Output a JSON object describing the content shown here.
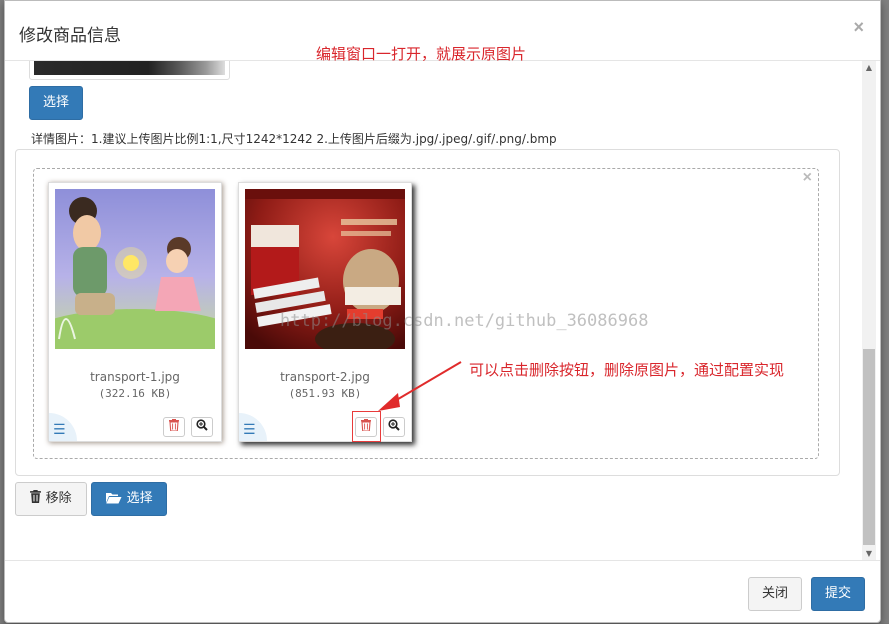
{
  "modal": {
    "title": "修改商品信息",
    "close_symbol": "×"
  },
  "annotations": {
    "top": "编辑窗口一打开，就展示原图片",
    "delete_hint": "可以点击删除按钮，删除原图片，通过配置实现"
  },
  "main_image": {
    "select_label": "选择"
  },
  "detail_hint": "详情图片：1.建议上传图片比例1:1,尺寸1242*1242   2.上传图片后缀为.jpg/.jpeg/.gif/.png/.bmp",
  "previews": [
    {
      "file_name": "transport-1.jpg",
      "file_size": "(322.16 KB)"
    },
    {
      "file_name": "transport-2.jpg",
      "file_size": "(851.93 KB)"
    }
  ],
  "zone_close_symbol": "×",
  "toolbar": {
    "remove_label": "移除",
    "browse_label": "选择"
  },
  "watermark": "http://blog.csdn.net/github_36086968",
  "footer": {
    "close_label": "关闭",
    "submit_label": "提交"
  },
  "colors": {
    "primary": "#337ab7",
    "annotation": "#d9262c",
    "danger": "#d9534f"
  },
  "icons": {
    "drag": "drag-handle-icon",
    "delete": "trash-icon",
    "zoom": "zoom-in-icon",
    "remove": "trash-icon",
    "browse": "folder-open-icon"
  }
}
